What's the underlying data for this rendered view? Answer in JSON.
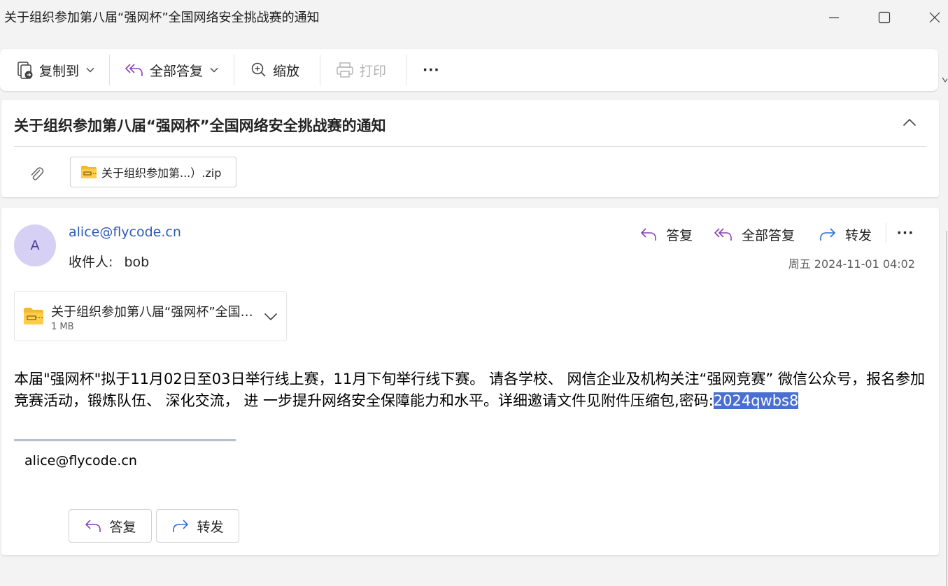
{
  "window": {
    "title": "关于组织参加第八届“强网杯”全国网络安全挑战赛的通知"
  },
  "toolbar": {
    "copy_to": "复制到",
    "reply_all": "全部答复",
    "zoom": "缩放",
    "print": "打印",
    "print_disabled": true,
    "more": "···"
  },
  "subject_card": {
    "subject": "关于组织参加第八届“强网杯”全国网络安全挑战赛的通知",
    "attachment_chip": "关于组织参加第...）.zip"
  },
  "message": {
    "avatar_initial": "A",
    "sender": "alice@flycode.cn",
    "recipient_label": "收件人:",
    "recipient": "bob",
    "actions": {
      "reply": "答复",
      "reply_all": "全部答复",
      "forward": "转发",
      "more": "···"
    },
    "date": "周五 2024-11-01 04:02",
    "attachment": {
      "name": "关于组织参加第八届“强网杯”全国网络安全挑战赛的通知.zip",
      "size": "1 MB"
    },
    "body_main": "本届\"强网杯\"拟于11月02日至03日举行线上赛，11月下旬举行线下赛。 请各学校、 网信企业及机构关注“强网竞赛” 微信公众号，报名参加竞赛活动，锻炼队伍、 深化交流， 进 一步提升网络安全保障能力和水平。详细邀请文件见附件压缩包,密码:",
    "body_password": "2024qwbs8",
    "signature": "alice@flycode.cn",
    "footer": {
      "reply": "答复",
      "forward": "转发"
    }
  },
  "colors": {
    "accent_purple": "#8a3fb5",
    "link_blue": "#2f5bb7",
    "forward_blue": "#2a6fd6",
    "selection": "#4a6fd1"
  }
}
